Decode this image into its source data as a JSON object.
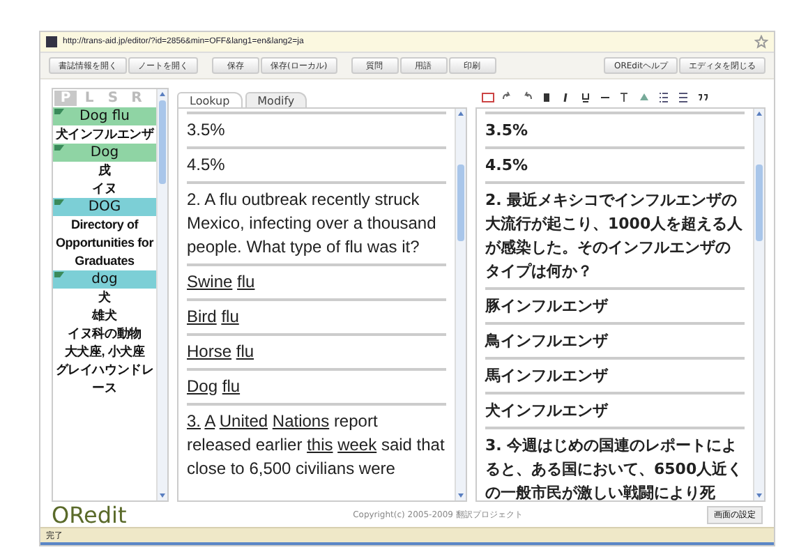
{
  "address_bar": {
    "url": "http://trans-aid.jp/editor/?id=2856&min=OFF&lang1=en&lang2=ja"
  },
  "toolbar": {
    "groups": [
      [
        "書誌情報を開く",
        "ノートを開く"
      ],
      [
        "保存",
        "保存(ローカル)"
      ],
      [
        "質問",
        "用語",
        "印刷"
      ],
      [
        "OREditヘルプ",
        "エディタを閉じる"
      ]
    ]
  },
  "sidebar": {
    "tabs": [
      {
        "label": "P",
        "selected": true
      },
      {
        "label": "L",
        "selected": false
      },
      {
        "label": "S",
        "selected": false
      },
      {
        "label": "R",
        "selected": false
      }
    ],
    "items": [
      {
        "kind": "header",
        "text": "Dog flu",
        "color": "#8fd4a4"
      },
      {
        "kind": "term",
        "text": "犬インフルエンザ"
      },
      {
        "kind": "header",
        "text": "Dog",
        "color": "#8fd4a4"
      },
      {
        "kind": "term",
        "text": "戌"
      },
      {
        "kind": "term",
        "text": "イヌ"
      },
      {
        "kind": "header",
        "text": "DOG",
        "color": "#7ccfd6"
      },
      {
        "kind": "term",
        "text": "Directory of Opportunities for Graduates"
      },
      {
        "kind": "header",
        "text": "dog",
        "color": "#7ccfd6"
      },
      {
        "kind": "term",
        "text": "犬"
      },
      {
        "kind": "term",
        "text": "雄犬"
      },
      {
        "kind": "term",
        "text": "イヌ科の動物"
      },
      {
        "kind": "term",
        "text": "大犬座, 小犬座"
      },
      {
        "kind": "term",
        "text": "グレイハウンドレース"
      }
    ]
  },
  "source_panel": {
    "tabs": [
      {
        "label": "Lookup",
        "selected": true
      },
      {
        "label": "Modify",
        "selected": false
      }
    ],
    "rows": [
      {
        "words": [
          {
            "text": "3.5%",
            "link": false
          }
        ]
      },
      {
        "words": [
          {
            "text": "4.5%",
            "link": false
          }
        ]
      },
      {
        "words": [
          {
            "text": "2. A flu outbreak recently struck Mexico, infecting over a thousand people. What type of flu was it?",
            "link": false
          }
        ]
      },
      {
        "words": [
          {
            "text": "Swine",
            "link": true
          },
          {
            "text": "flu",
            "link": true
          }
        ]
      },
      {
        "words": [
          {
            "text": "Bird",
            "link": true
          },
          {
            "text": "flu",
            "link": true
          }
        ]
      },
      {
        "words": [
          {
            "text": "Horse",
            "link": true
          },
          {
            "text": "flu",
            "link": true
          }
        ]
      },
      {
        "words": [
          {
            "text": "Dog",
            "link": true
          },
          {
            "text": "flu",
            "link": true
          }
        ]
      },
      {
        "words": [
          {
            "text": "3.",
            "link": true
          },
          {
            "text": "A",
            "link": true
          },
          {
            "text": "United",
            "link": true
          },
          {
            "text": "Nations",
            "link": true
          },
          {
            "text": "report released earlier",
            "link": false
          },
          {
            "text": "this",
            "link": true
          },
          {
            "text": "week",
            "link": true
          },
          {
            "text": "said that close to 6,500 civilians were",
            "link": false
          }
        ]
      }
    ]
  },
  "target_panel": {
    "rows": [
      "3.5%",
      "4.5%",
      "2. 最近メキシコでインフルエンザの大流行が起こり、1000人を超える人が感染した。そのインフルエンザのタイプは何か？",
      "豚インフルエンザ",
      "鳥インフルエンザ",
      "馬インフルエンザ",
      "犬インフルエンザ",
      "3. 今週はじめの国連のレポートによると、ある国において、6500人近くの一般市民が激しい戦闘により死"
    ]
  },
  "footer": {
    "logo": "ORedit",
    "copyright": "Copyright(c) 2005-2009 翻訳プロジェクト",
    "settings_button": "画面の設定"
  },
  "status_bar": {
    "text": "完了"
  }
}
